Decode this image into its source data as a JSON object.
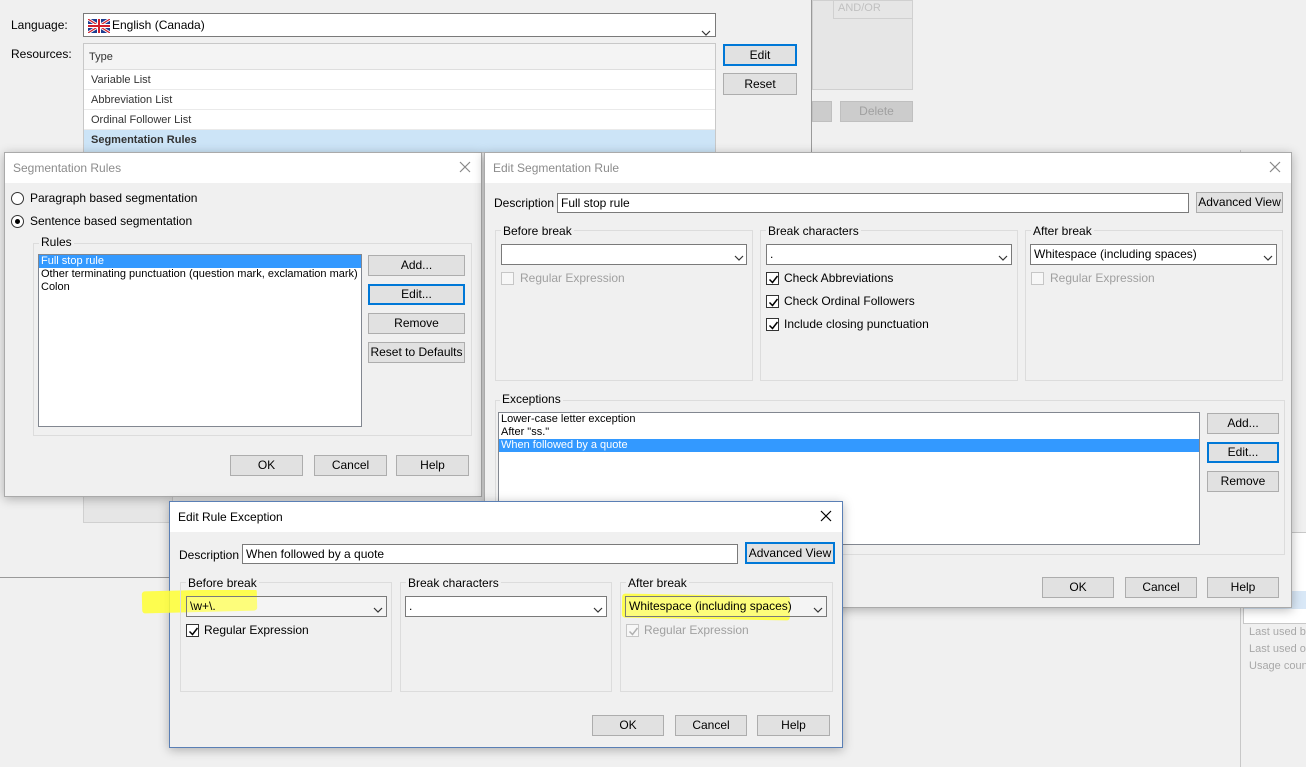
{
  "icons": {
    "flag": "canada-flag-icon",
    "close": "close-icon",
    "dropdown": "chevron-down-icon",
    "check": "checkmark-icon"
  },
  "colors": {
    "selection": "#3399ff",
    "focus_border": "#0078d7",
    "highlighter": "#ffff33"
  },
  "main": {
    "language_label": "Language:",
    "language_value": "English (Canada)",
    "resources_label": "Resources:",
    "resources_header": "Type",
    "resources": [
      "Variable List",
      "Abbreviation List",
      "Ordinal Follower List",
      "Segmentation Rules"
    ],
    "edit_button": "Edit",
    "reset_button": "Reset",
    "delete_button": "Delete",
    "andor_header": "AND/OR"
  },
  "right_strip": {
    "items": [
      "Last used by",
      "Last used on",
      "Usage count"
    ]
  },
  "seg_rules": {
    "title": "Segmentation Rules",
    "paragraph_option": "Paragraph based segmentation",
    "sentence_option": "Sentence based segmentation",
    "rules_group": "Rules",
    "rules": [
      "Full stop rule",
      "Other terminating punctuation (question mark, exclamation mark)",
      "Colon"
    ],
    "add_button": "Add...",
    "edit_button": "Edit...",
    "remove_button": "Remove",
    "reset_defaults_button": "Reset to Defaults",
    "ok_button": "OK",
    "cancel_button": "Cancel",
    "help_button": "Help"
  },
  "edit_rule": {
    "title": "Edit Segmentation Rule",
    "description_label": "Description",
    "description_value": "Full stop rule",
    "advanced_view_button": "Advanced View",
    "before_break_group": "Before break",
    "before_break_value": "",
    "before_regex_label": "Regular Expression",
    "break_chars_group": "Break characters",
    "break_chars_value": ".",
    "check_abbreviations": "Check Abbreviations",
    "check_ordinal": "Check Ordinal Followers",
    "include_closing": "Include closing punctuation",
    "after_break_group": "After break",
    "after_break_value": "Whitespace (including spaces)",
    "after_regex_label": "Regular Expression",
    "exceptions_group": "Exceptions",
    "exceptions": [
      "Lower-case letter exception",
      "After \"ss.\"",
      "When followed by a quote"
    ],
    "add_button": "Add...",
    "edit_button": "Edit...",
    "remove_button": "Remove",
    "ok_button": "OK",
    "cancel_button": "Cancel",
    "help_button": "Help"
  },
  "edit_exception": {
    "title": "Edit Rule Exception",
    "description_label": "Description",
    "description_value": "When followed by a quote",
    "advanced_view_button": "Advanced View",
    "before_break_group": "Before break",
    "before_break_value": "\\w+\\.",
    "before_regex_label": "Regular Expression",
    "break_chars_group": "Break characters",
    "break_chars_value": ".",
    "after_break_group": "After break",
    "after_break_value": "Whitespace (including spaces)",
    "after_regex_label": "Regular Expression",
    "ok_button": "OK",
    "cancel_button": "Cancel",
    "help_button": "Help"
  }
}
